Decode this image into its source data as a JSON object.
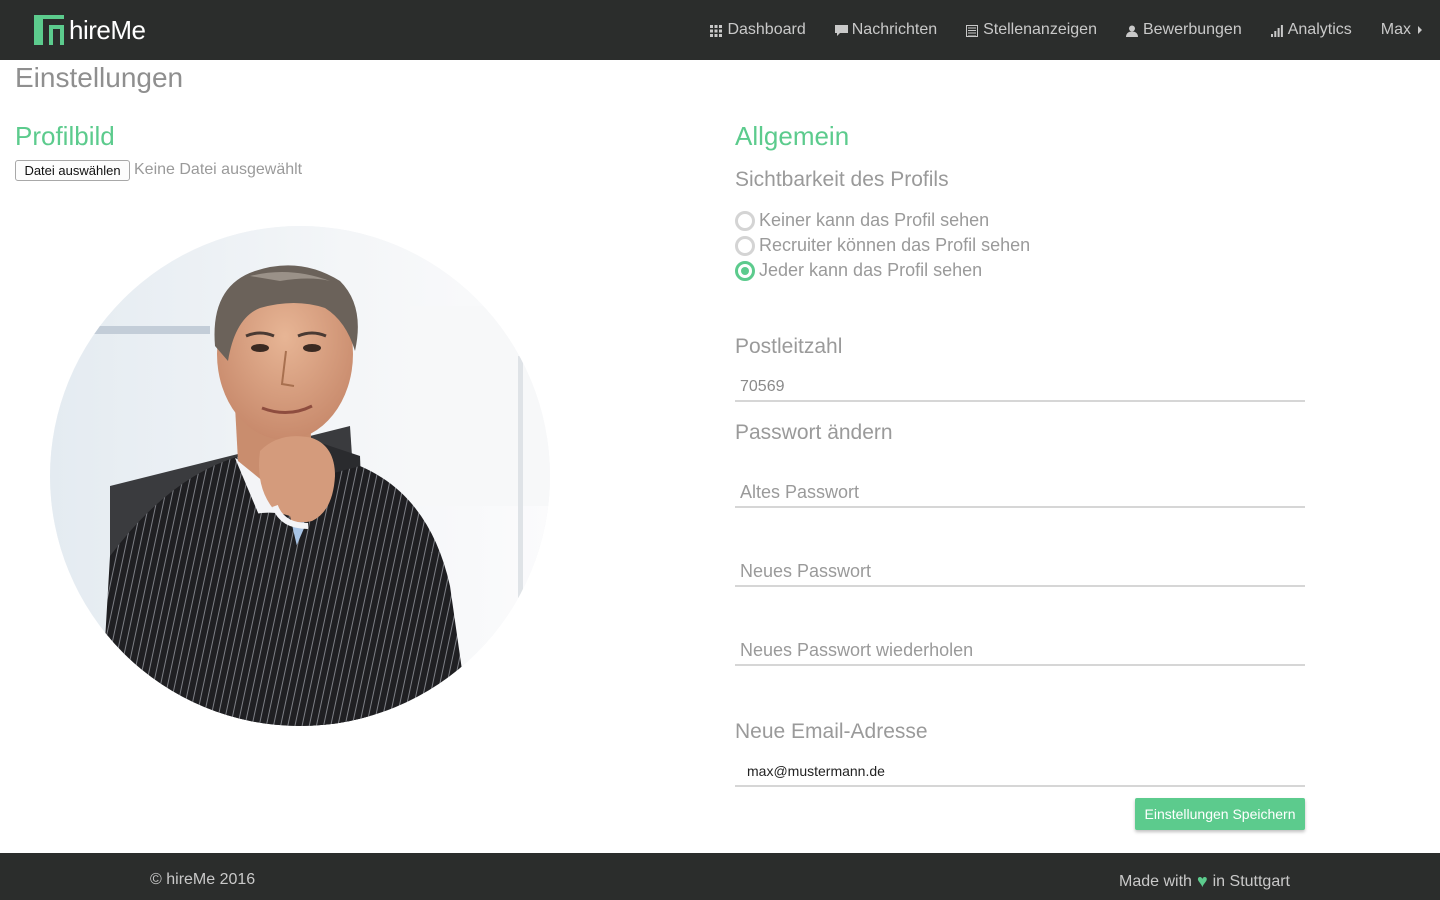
{
  "brand": {
    "name": "hireMe",
    "accent_color": "#5ccb8d"
  },
  "nav": {
    "items": [
      {
        "label": "Dashboard",
        "icon": "grid-icon"
      },
      {
        "label": "Nachrichten",
        "icon": "chat-bubble-icon"
      },
      {
        "label": "Stellenanzeigen",
        "icon": "list-icon"
      },
      {
        "label": "Bewerbungen",
        "icon": "user-icon"
      },
      {
        "label": "Analytics",
        "icon": "bar-chart-icon"
      }
    ],
    "user_menu": {
      "label": "Max",
      "icon": "caret-right-icon"
    }
  },
  "page": {
    "title": "Einstellungen"
  },
  "profile_picture": {
    "section_title": "Profilbild",
    "file_button_label": "Datei auswählen",
    "file_status": "Keine Datei ausgewählt"
  },
  "general": {
    "section_title": "Allgemein",
    "visibility": {
      "title": "Sichtbarkeit des Profils",
      "options": [
        {
          "label": "Keiner kann das Profil sehen",
          "checked": false
        },
        {
          "label": "Recruiter können das Profil sehen",
          "checked": false
        },
        {
          "label": "Jeder kann das Profil sehen",
          "checked": true
        }
      ]
    },
    "postal_code": {
      "title": "Postleitzahl",
      "value": "70569"
    },
    "password": {
      "title": "Passwort ändern",
      "old_placeholder": "Altes Passwort",
      "new_placeholder": "Neues Passwort",
      "repeat_placeholder": "Neues Passwort wiederholen"
    },
    "email": {
      "title": "Neue Email-Adresse",
      "value": "max@mustermann.de"
    },
    "save_label": "Einstellungen Speichern"
  },
  "footer": {
    "copyright": "© hireMe 2016",
    "made_prefix": "Made with",
    "made_suffix": "in Stuttgart",
    "heart_icon": "heart-icon"
  }
}
